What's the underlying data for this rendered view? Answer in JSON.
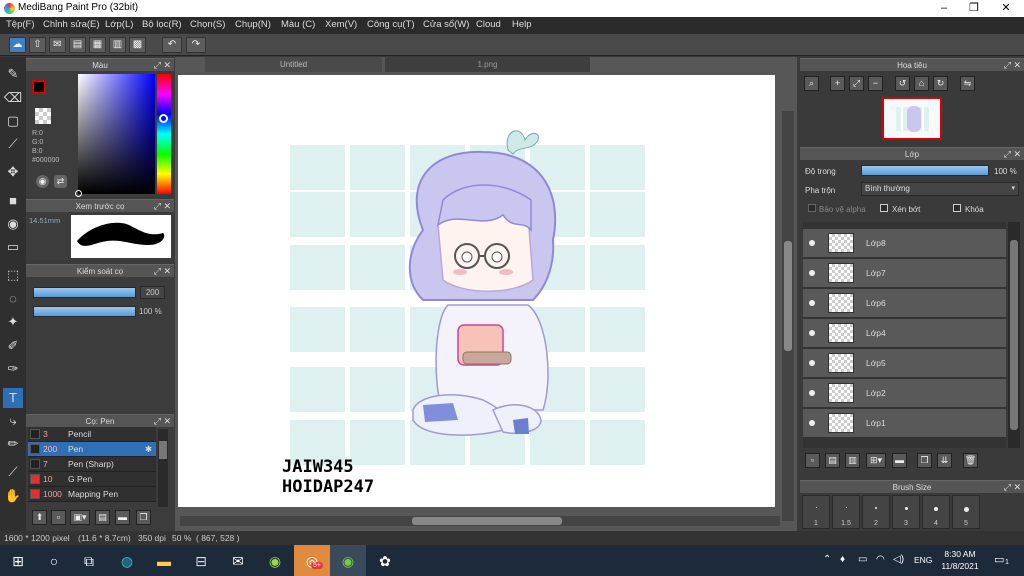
{
  "window": {
    "title": "MediBang Paint Pro (32bit)",
    "minimize": "–",
    "maximize": "❐",
    "close": "✕"
  },
  "menu": [
    "Tệp(F)",
    "Chỉnh sửa(E)",
    "Lớp(L)",
    "Bộ lọc(R)",
    "Chọn(S)",
    "Chụp(N)",
    "Màu (C)",
    "Xem(V)",
    "Công cụ(T)",
    "Cửa sổ(W)",
    "Cloud",
    "Help"
  ],
  "toolbar": {
    "undo": "↶",
    "redo": "↷"
  },
  "color_panel": {
    "title": "Màu",
    "r": "R:0",
    "g": "G:0",
    "b": "B:0",
    "hex": "#000000"
  },
  "brush_preview": {
    "title": "Xem trước cọ",
    "size": "14.51mm"
  },
  "brush_control": {
    "title": "Kiểm soát cọ",
    "size_value": "200",
    "opacity_value": "100 %",
    "size_fraction": 1.0,
    "opacity_fraction": 1.0
  },
  "brush_list": {
    "title": "Cọ: Pen",
    "items": [
      {
        "size": "3",
        "name": "Pencil",
        "color": "#222222",
        "selected": false
      },
      {
        "size": "200",
        "name": "Pen",
        "color": "#222222",
        "selected": true
      },
      {
        "size": "7",
        "name": "Pen (Sharp)",
        "color": "#222222",
        "selected": false
      },
      {
        "size": "10",
        "name": "G Pen",
        "color": "#e03030",
        "selected": false
      },
      {
        "size": "1000",
        "name": "Mapping Pen",
        "color": "#e03030",
        "selected": false
      }
    ]
  },
  "tabs": {
    "tab1": "Untitled",
    "tab2": "1.png"
  },
  "canvas": {
    "watermark_line1": "JAIW345",
    "watermark_line2": "HOIDAP247"
  },
  "navigator": {
    "title": "Hoa tiêu"
  },
  "layer_panel": {
    "title": "Lớp",
    "opacity_label": "Độ trong",
    "opacity_value": "100 %",
    "blend_label": "Pha trộn",
    "blend_value": "Bình thường",
    "protect_alpha": "Bảo vệ alpha",
    "clipping": "Xén bớt",
    "lock": "Khóa",
    "layers": [
      "Lớp8",
      "Lớp7",
      "Lớp6",
      "Lớp4",
      "Lớp5",
      "Lớp2",
      "Lớp1"
    ]
  },
  "brush_size": {
    "title": "Brush Size",
    "sizes": [
      "1",
      "1.5",
      "2",
      "3",
      "4",
      "5"
    ]
  },
  "status": {
    "dimensions": "1600 * 1200 pixel",
    "physical": "(11.6 * 8.7cm)",
    "dpi": "350 dpi",
    "zoom": "50 %",
    "coords": "( 867, 528 )"
  },
  "taskbar": {
    "lang": "ENG",
    "time": "8:30 AM",
    "date": "11/8/2021",
    "badge": "5+",
    "notif": "1"
  }
}
